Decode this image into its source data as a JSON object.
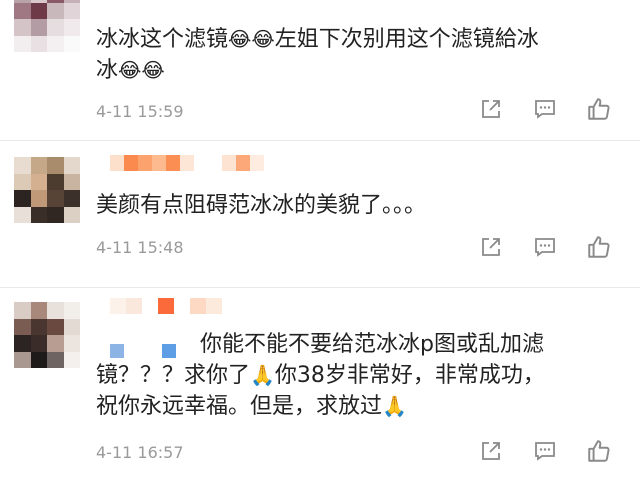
{
  "comments": [
    {
      "text_1": "冰冰这个滤镜",
      "emoji_1": "😂😂",
      "text_2": "左姐下次别用这个滤镜給冰",
      "text_3": "冰",
      "emoji_2": "😂😂",
      "time": "4-11 15:59"
    },
    {
      "text_1": "美颜有点阻碍范冰冰的美貌了。。。",
      "time": "4-11 15:48"
    },
    {
      "text_1": "你能不能不要给范冰冰p图或乱加滤",
      "text_2": "镜？？？求你了",
      "emoji_1": "🙏",
      "text_3": "你38岁非常好，非常成功，",
      "text_4": "祝你永远幸福。但是，求放过",
      "emoji_2": "🙏",
      "time": "4-11 16:57"
    }
  ],
  "icons": {
    "share": "share-icon",
    "comment": "comment-icon",
    "like": "like-icon"
  },
  "colors": {
    "text": "#222222",
    "time": "#9a9a9a",
    "icon": "#8a8a8a",
    "divider": "#e8e8e8"
  }
}
